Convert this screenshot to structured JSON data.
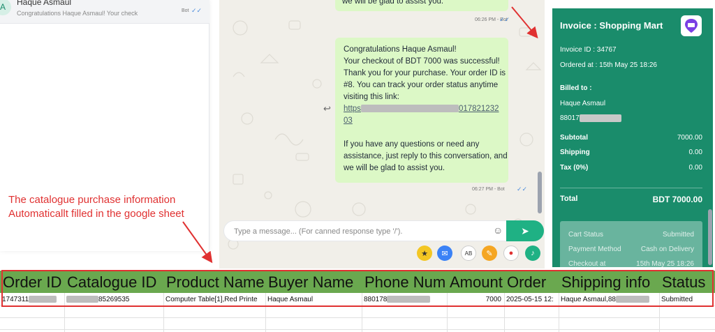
{
  "chat_list": {
    "avatar_letter": "A",
    "name": "Haque Asmaul",
    "preview": "Congratulations Haque Asmaul! Your check",
    "bot_tag": "Bot",
    "ticks": "✓✓"
  },
  "chat": {
    "bubble1_text": "we will be glad to assist you.",
    "bubble1_time": "06:26 PM - Bot",
    "bubble2": {
      "line1": "Congratulations Haque Asmaul!",
      "line2": "Your checkout of BDT 7000 was successful!",
      "line3": "Thank you for your purchase. Your order ID is",
      "line4": "#8. You can track your order status anytime",
      "line5": "visiting this link:",
      "link_start": "https",
      "link_end": "017821232",
      "link_line2": "03",
      "line6": "If you have any questions or need any",
      "line7": "assistance, just reply to this conversation, and",
      "line8": "we will be glad to assist you."
    },
    "bubble2_time": "06:27 PM - Bot",
    "ticks": "✓✓",
    "input_placeholder": "Type a message... (For canned response type '/')."
  },
  "invoice": {
    "title": "Invoice : Shopping Mart",
    "invoice_id": "Invoice ID : 34767",
    "ordered_at": "Ordered at : 15th May 25 18:26",
    "billed_to_label": "Billed to :",
    "billed_name": "Haque Asmaul",
    "billed_phone": "88017",
    "subtotal_label": "Subtotal",
    "subtotal_value": "7000.00",
    "shipping_label": "Shipping",
    "shipping_value": "0.00",
    "tax_label": "Tax (0%)",
    "tax_value": "0.00",
    "total_label": "Total",
    "total_value": "BDT 7000.00",
    "cart_status_label": "Cart Status",
    "cart_status_value": "Submitted",
    "payment_method_label": "Payment Method",
    "payment_method_value": "Cash on Delivery",
    "checkout_label": "Checkout at",
    "checkout_value": "15th May 25 18:26",
    "colors": {
      "background": "#1a8c6b",
      "logo_accent": "#7b3fe4"
    }
  },
  "annotation": {
    "line1": "The catalogue purchase information",
    "line2": "Automaticallt filled in the google sheet",
    "color": "#e03131"
  },
  "sheet": {
    "header_color": "#6aa84f",
    "headers": [
      "Order ID",
      "Catalogue ID",
      "Product Name",
      "Buyer Name",
      "Phone Num",
      "Amount",
      "Order",
      "Shipping info",
      "Status"
    ],
    "row": {
      "order_id": "1747311",
      "catalogue_id": "85269535",
      "product_name": "Computer Table[1],Red Printe",
      "buyer_name": "Haque Asmaul",
      "phone_num": "880178",
      "amount": "7000",
      "order": "2025-05-15 12:",
      "shipping_info_start": "Haque Asmaul,88",
      "status": "Submitted"
    }
  },
  "tools": {
    "star_icon": "star-icon",
    "chat_icon": "chat-bubble-icon",
    "ab_icon": "spellcheck-icon",
    "attach_icon": "paperclip-icon",
    "location_icon": "location-pin-icon",
    "mic_icon": "microphone-icon"
  }
}
